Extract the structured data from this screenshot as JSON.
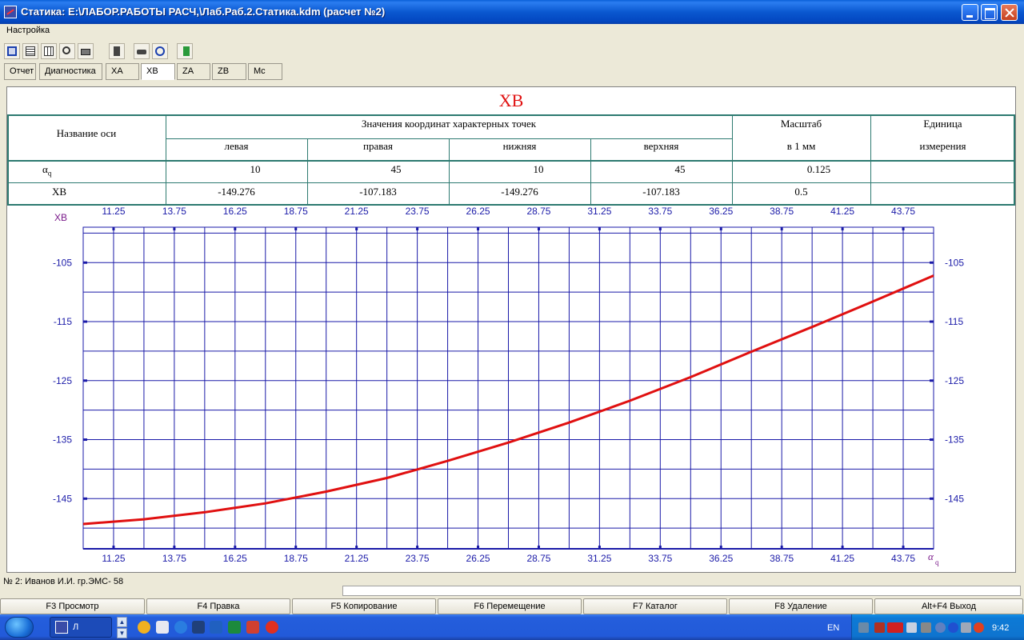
{
  "window": {
    "title": "Статика: E:\\ЛАБОР.РАБОТЫ РАСЧ,\\Лаб.Раб.2.Статика.kdm (расчет №2)"
  },
  "menu": {
    "items": [
      "Настройка"
    ]
  },
  "toolbar": {
    "icons": [
      "save-icon",
      "table-icon",
      "grid-icon",
      "zoom-icon",
      "print-icon",
      "calculator-icon",
      "car-icon",
      "copyright-icon",
      "exit-icon"
    ]
  },
  "tabs": [
    {
      "label": "Отчет"
    },
    {
      "label": "Диагностика"
    },
    {
      "label": "XA"
    },
    {
      "label": "XB",
      "active": true
    },
    {
      "label": "ZA"
    },
    {
      "label": "ZB"
    },
    {
      "label": "Mc"
    }
  ],
  "heading": "XB",
  "table": {
    "axis_name_header": "Название оси",
    "coords_header": "Значения координат характерных точек",
    "scale_header": [
      "Масштаб",
      "в 1 мм"
    ],
    "unit_header": [
      "Единица",
      "измерения"
    ],
    "subheaders": [
      "левая",
      "правая",
      "нижняя",
      "верхняя"
    ],
    "rows": [
      {
        "name": "α",
        "sub": "q",
        "values": [
          "10",
          "45",
          "10",
          "45"
        ],
        "scale": "0.125",
        "unit": ""
      },
      {
        "name": "XB",
        "sub": "",
        "values": [
          "-149.276",
          "-107.183",
          "-149.276",
          "-107.183"
        ],
        "scale": "0.5",
        "unit": ""
      }
    ]
  },
  "chart_data": {
    "type": "line",
    "ylabel": "XB",
    "xlabel": "α",
    "xlabel_sub": "q",
    "xlim": [
      10,
      45
    ],
    "ylim": [
      -153.5,
      -99
    ],
    "x_ticks": [
      "11.25",
      "13.75",
      "16.25",
      "18.75",
      "21.25",
      "23.75",
      "26.25",
      "28.75",
      "31.25",
      "33.75",
      "36.25",
      "38.75",
      "41.25",
      "43.75"
    ],
    "y_ticks": [
      "-105",
      "-115",
      "-125",
      "-135",
      "-145"
    ],
    "grid": true,
    "series": [
      {
        "color": "#e01010",
        "x": [
          10,
          12.5,
          15,
          17.5,
          20,
          22.5,
          25,
          27.5,
          30,
          32.5,
          35,
          37.5,
          40,
          42.5,
          45
        ],
        "y": [
          -149.3,
          -148.5,
          -147.3,
          -145.8,
          -143.8,
          -141.5,
          -138.6,
          -135.5,
          -132.1,
          -128.4,
          -124.4,
          -120.1,
          -115.9,
          -111.6,
          -107.2
        ]
      }
    ]
  },
  "status": {
    "text": "№ 2: Иванов И.И. гр.ЭМС- 58"
  },
  "fkeys": [
    "F3 Просмотр",
    "F4 Правка",
    "F5 Копирование",
    "F6 Перемещение",
    "F7 Каталог",
    "F8 Удаление",
    "Alt+F4 Выход"
  ],
  "taskbar": {
    "task_label": "Л",
    "lang": "EN",
    "clock": "9:42"
  }
}
